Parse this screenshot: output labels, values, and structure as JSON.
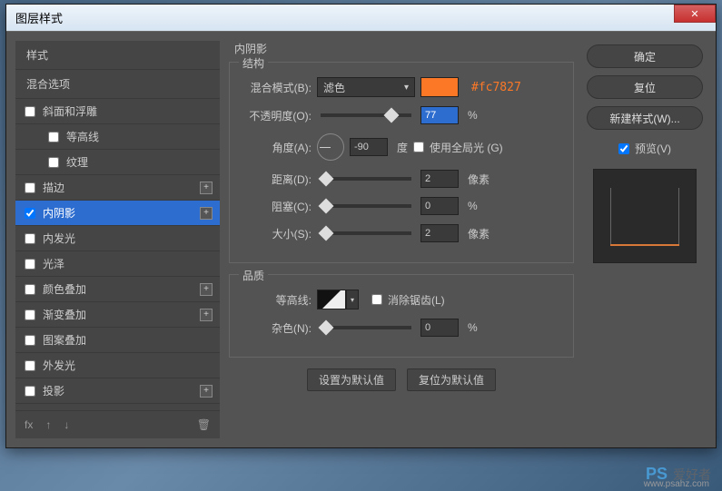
{
  "title": "图层样式",
  "close": "✕",
  "left": {
    "styles_header": "样式",
    "blend_options": "混合选项",
    "items": [
      {
        "label": "斜面和浮雕",
        "checked": false,
        "add": false,
        "indent": false
      },
      {
        "label": "等高线",
        "checked": false,
        "add": false,
        "indent": true
      },
      {
        "label": "纹理",
        "checked": false,
        "add": false,
        "indent": true
      },
      {
        "label": "描边",
        "checked": false,
        "add": true,
        "indent": false
      },
      {
        "label": "内阴影",
        "checked": true,
        "add": true,
        "indent": false,
        "active": true
      },
      {
        "label": "内发光",
        "checked": false,
        "add": false,
        "indent": false
      },
      {
        "label": "光泽",
        "checked": false,
        "add": false,
        "indent": false
      },
      {
        "label": "颜色叠加",
        "checked": false,
        "add": true,
        "indent": false
      },
      {
        "label": "渐变叠加",
        "checked": false,
        "add": true,
        "indent": false
      },
      {
        "label": "图案叠加",
        "checked": false,
        "add": false,
        "indent": false
      },
      {
        "label": "外发光",
        "checked": false,
        "add": false,
        "indent": false
      },
      {
        "label": "投影",
        "checked": false,
        "add": true,
        "indent": false
      }
    ],
    "footer": {
      "fx": "fx",
      "trash": "🗑"
    }
  },
  "center": {
    "title": "内阴影",
    "structure": {
      "legend": "结构",
      "blend_mode_label": "混合模式(B):",
      "blend_mode_value": "滤色",
      "color_hex": "#fc7827",
      "opacity_label": "不透明度(O):",
      "opacity_value": "77",
      "opacity_unit": "%",
      "angle_label": "角度(A):",
      "angle_value": "-90",
      "angle_unit": "度",
      "global_light": "使用全局光 (G)",
      "distance_label": "距离(D):",
      "distance_value": "2",
      "distance_unit": "像素",
      "choke_label": "阻塞(C):",
      "choke_value": "0",
      "choke_unit": "%",
      "size_label": "大小(S):",
      "size_value": "2",
      "size_unit": "像素"
    },
    "quality": {
      "legend": "品质",
      "contour_label": "等高线:",
      "antialias": "消除锯齿(L)",
      "noise_label": "杂色(N):",
      "noise_value": "0",
      "noise_unit": "%"
    },
    "set_default": "设置为默认值",
    "reset_default": "复位为默认值"
  },
  "right": {
    "ok": "确定",
    "cancel": "复位",
    "new_style": "新建样式(W)...",
    "preview": "预览(V)"
  },
  "watermark": {
    "logo": "PS",
    "text": "爱好者",
    "url": "www.psahz.com"
  }
}
